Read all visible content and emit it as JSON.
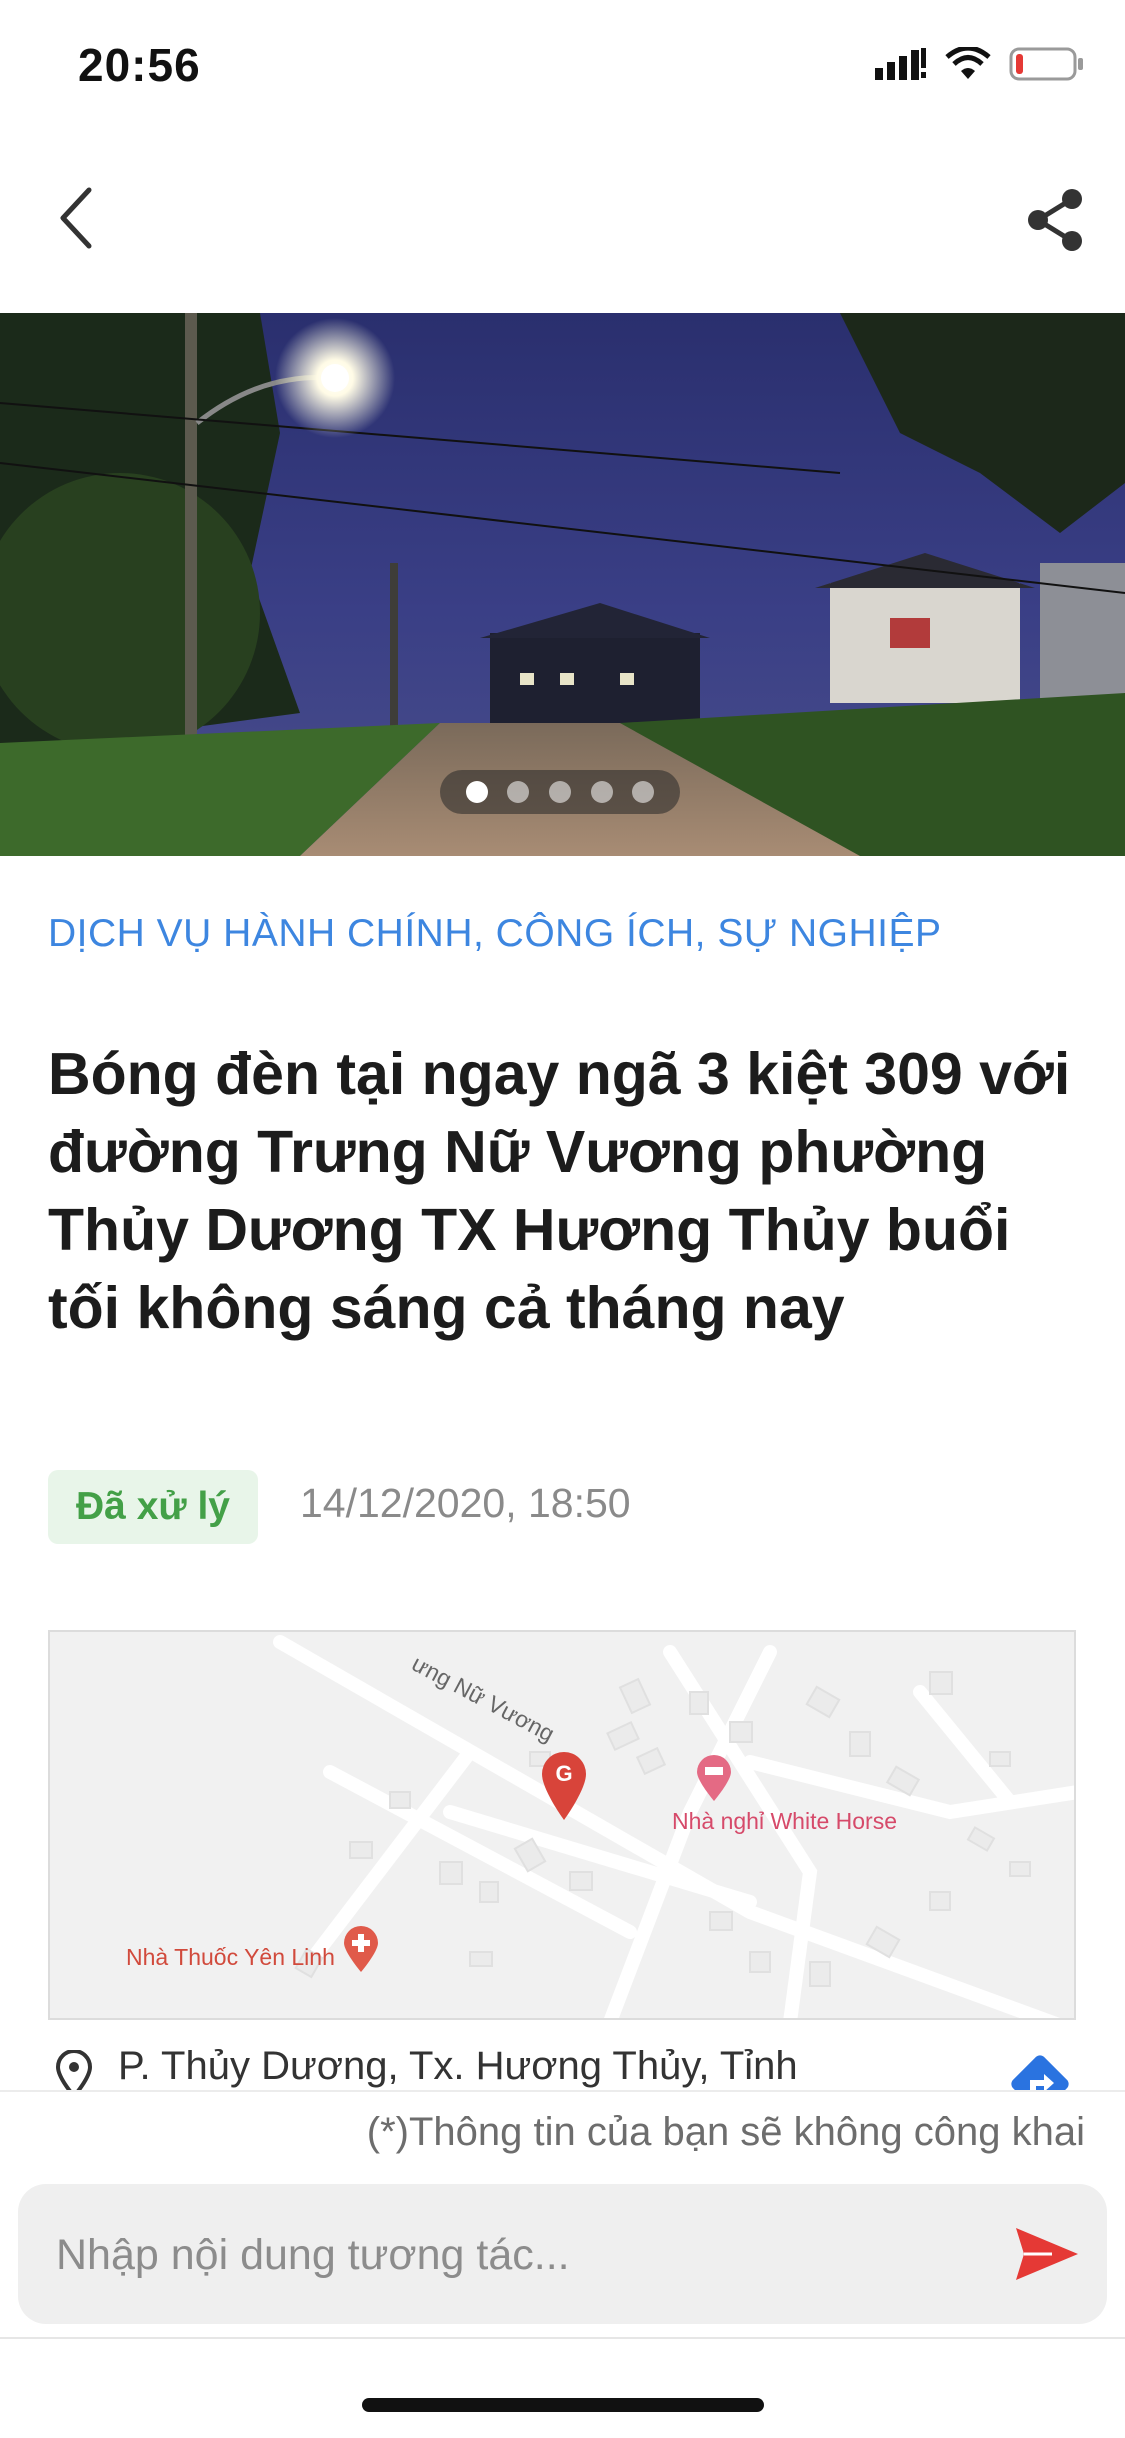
{
  "status_bar": {
    "time": "20:56"
  },
  "article": {
    "category": "DỊCH VỤ HÀNH CHÍNH, CÔNG ÍCH, SỰ NGHIỆP",
    "title": "Bóng đèn tại ngay ngã 3 kiệt 309 với đường Trưng Nữ Vương phường Thủy Dương TX Hương Thủy buổi tối không sáng cả tháng nay",
    "status": "Đã xử lý",
    "datetime": "14/12/2020, 18:50"
  },
  "carousel": {
    "count": 5,
    "active_index": 0
  },
  "map": {
    "street_label": "ưng Nữ Vương",
    "marker_letter": "G",
    "poi_hotel": "Nhà nghỉ White Horse",
    "poi_pharmacy": "Nhà Thuốc Yên Linh"
  },
  "address": {
    "text": "P. Thủy Dương, Tx. Hương Thủy, Tỉnh"
  },
  "compose": {
    "privacy_note": "(*)Thông tin của bạn sẽ không công khai",
    "placeholder": "Nhập nội dung tương tác..."
  },
  "colors": {
    "accent": "#3d86e0",
    "status_green": "#43a047",
    "send_red": "#e53935",
    "map_marker": "#d8443a"
  },
  "icons": [
    "back-chevron-icon",
    "share-icon",
    "location-pin-icon",
    "directions-icon",
    "send-icon"
  ]
}
